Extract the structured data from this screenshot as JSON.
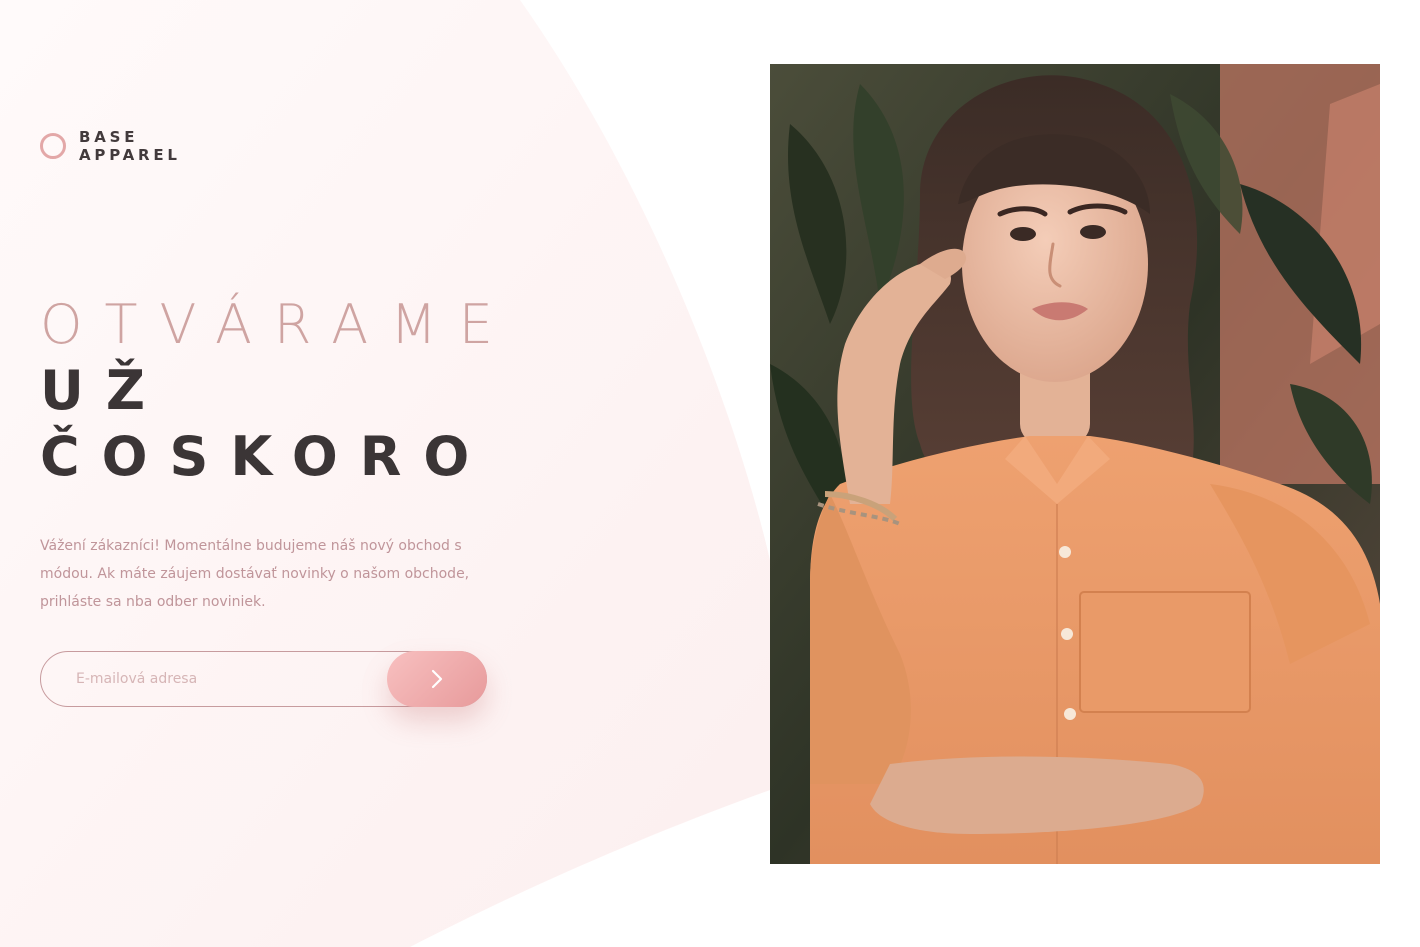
{
  "brand": {
    "line1": "BASE",
    "line2": "APPAREL",
    "accent_color": "#e3a8a8"
  },
  "headline": {
    "line1": "OTVÁRAME",
    "line2": "UŽ",
    "line3": "ČOSKORO",
    "light_color": "#cfa4a2",
    "dark_color": "#3b3536"
  },
  "description": "Vážení zákazníci! Momentálne budujeme náš nový obchod s módou. Ak máte záujem dostávať novinky o našom obchode, prihláste sa nba odber noviniek.",
  "signup": {
    "placeholder": "E-mailová adresa",
    "value": "",
    "button_icon": "chevron-right-icon",
    "button_color": "#e79a9b"
  },
  "hero": {
    "image_subject": "woman-in-orange-shirt-photo"
  }
}
